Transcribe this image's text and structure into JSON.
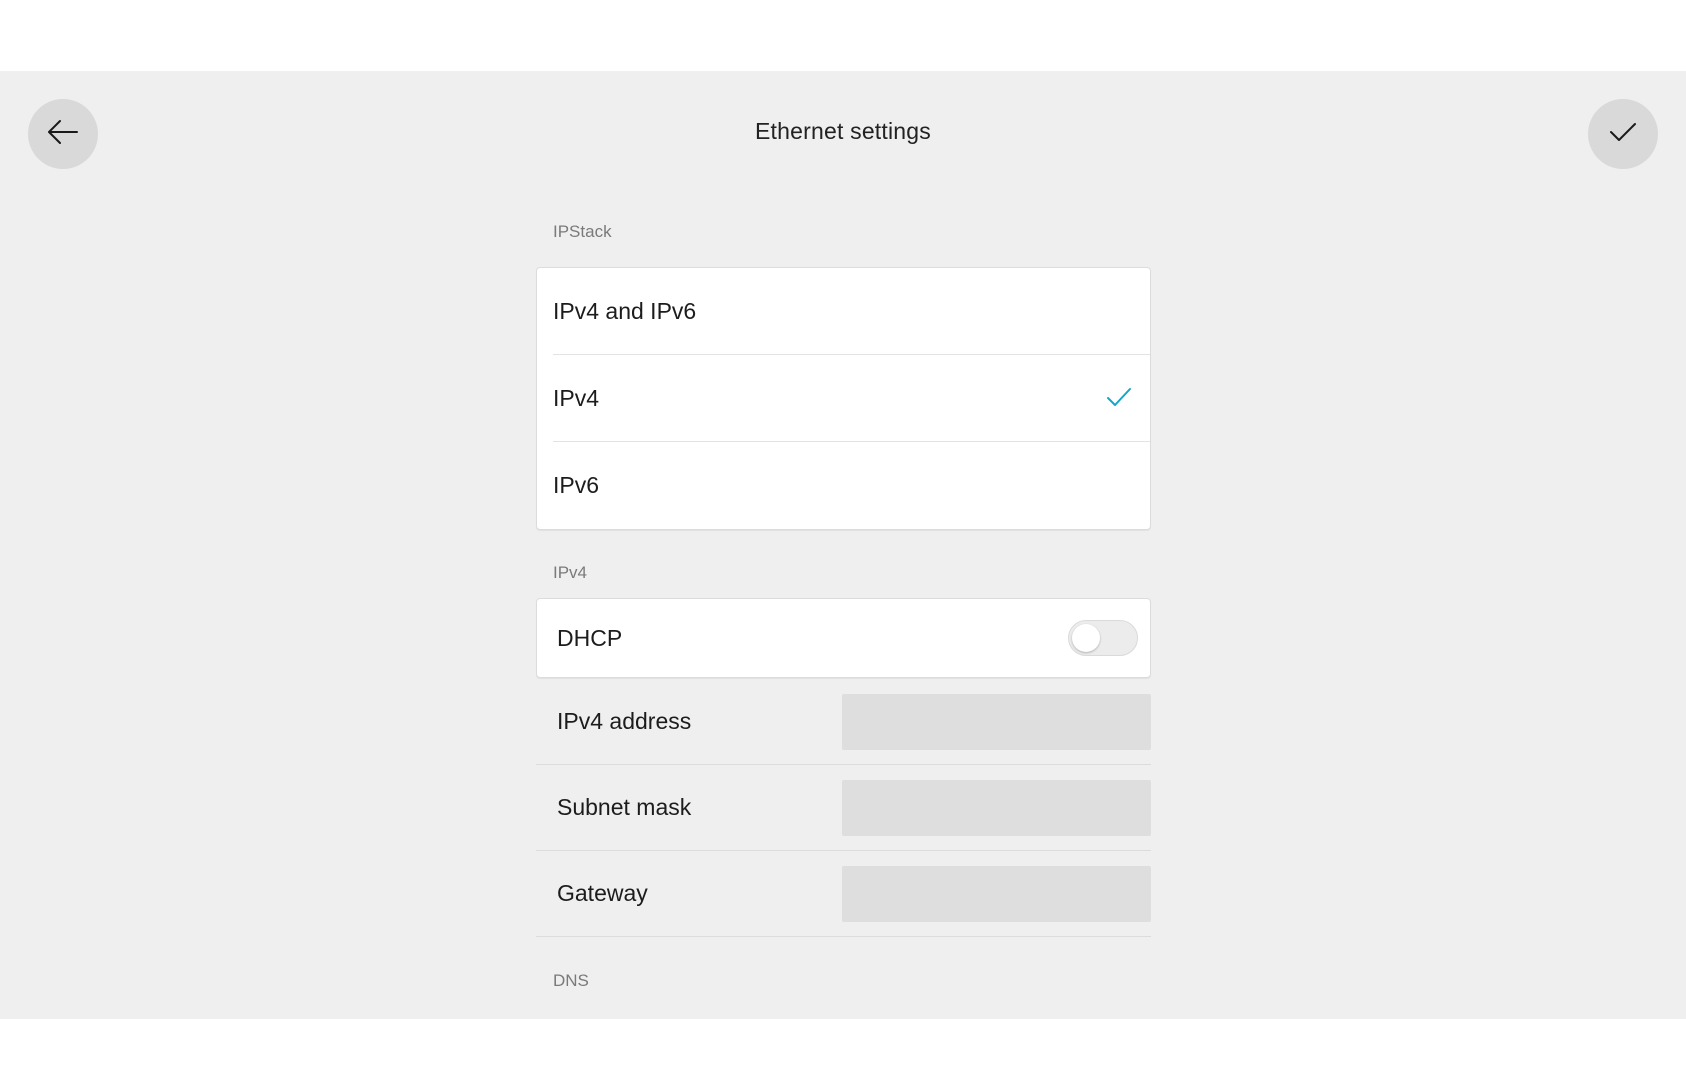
{
  "header": {
    "title": "Ethernet settings",
    "back_icon": "arrow-left-icon",
    "confirm_icon": "checkmark-icon"
  },
  "ipstack": {
    "section_label": "IPStack",
    "options": [
      {
        "label": "IPv4 and IPv6",
        "selected": false
      },
      {
        "label": "IPv4",
        "selected": true
      },
      {
        "label": "IPv6",
        "selected": false
      }
    ],
    "check_color": "#14a5c9"
  },
  "ipv4": {
    "section_label": "IPv4",
    "dhcp": {
      "label": "DHCP",
      "enabled": false
    },
    "fields": [
      {
        "label": "IPv4 address",
        "value": ""
      },
      {
        "label": "Subnet mask",
        "value": ""
      },
      {
        "label": "Gateway",
        "value": ""
      }
    ]
  },
  "dns": {
    "section_label": "DNS"
  }
}
